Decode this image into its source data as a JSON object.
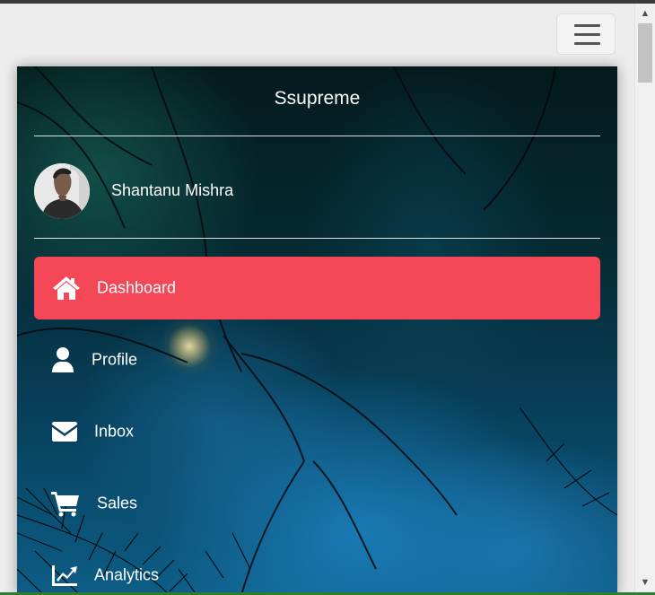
{
  "brand": {
    "title": "Ssupreme"
  },
  "user": {
    "name": "Shantanu Mishra",
    "avatar_icon": "user-avatar"
  },
  "menu": {
    "items": [
      {
        "label": "Dashboard",
        "icon": "home-icon",
        "active": true
      },
      {
        "label": "Profile",
        "icon": "user-icon",
        "active": false
      },
      {
        "label": "Inbox",
        "icon": "envelope-icon",
        "active": false
      },
      {
        "label": "Sales",
        "icon": "cart-icon",
        "active": false
      },
      {
        "label": "Analytics",
        "icon": "chart-line-icon",
        "active": false
      }
    ]
  },
  "navbar": {
    "toggle_icon": "hamburger-icon"
  },
  "colors": {
    "active_item": "#f54758",
    "text": "#ffffff",
    "page_background": "#ededed"
  }
}
